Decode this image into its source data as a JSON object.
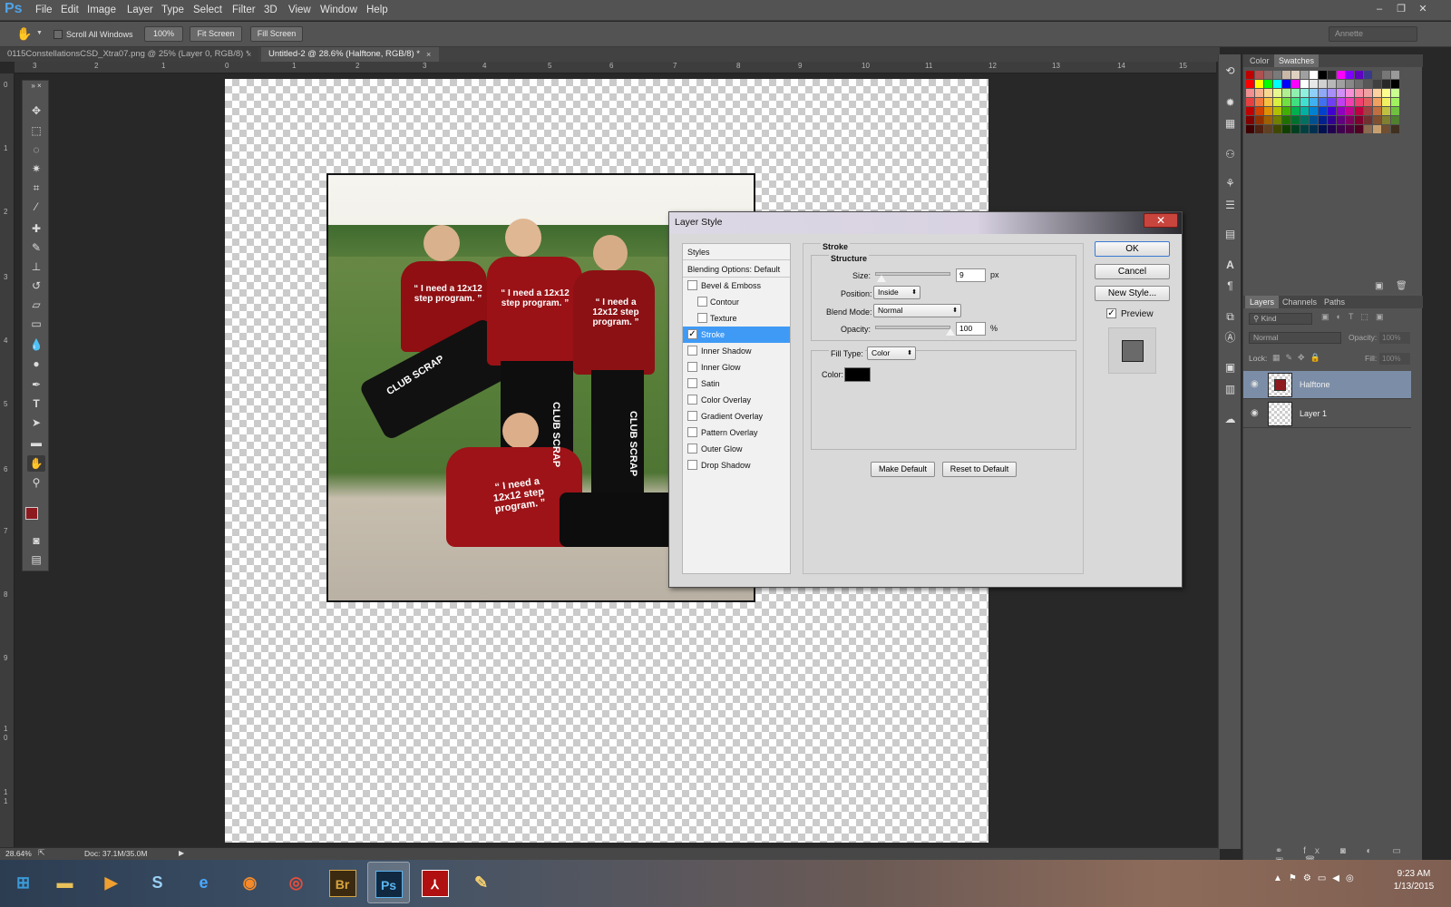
{
  "app": {
    "logo": "Ps",
    "user_workspace": "Annette"
  },
  "menu": [
    "File",
    "Edit",
    "Image",
    "Layer",
    "Type",
    "Select",
    "Filter",
    "3D",
    "View",
    "Window",
    "Help"
  ],
  "window_controls": [
    "–",
    "❐",
    "✕"
  ],
  "options_bar": {
    "scroll_all_windows": "Scroll All Windows",
    "zoom_100": "100%",
    "fit_screen": "Fit Screen",
    "fill_screen": "Fill Screen"
  },
  "doc_tabs": [
    {
      "label": "0115ConstellationsCSD_Xtra07.png @ 25% (Layer 0, RGB/8) *",
      "active": false
    },
    {
      "label": "Untitled-2 @ 28.6% (Halftone, RGB/8) *",
      "active": true
    }
  ],
  "ruler": {
    "h": [
      "3",
      "2",
      "1",
      "0",
      "1",
      "2",
      "3",
      "4",
      "5",
      "6",
      "7",
      "8",
      "9",
      "10",
      "11",
      "12",
      "13",
      "14",
      "15"
    ],
    "v": [
      "0",
      "1",
      "2",
      "3",
      "4",
      "5",
      "6",
      "7",
      "8",
      "9",
      "1",
      "0",
      "1",
      "1"
    ]
  },
  "status": {
    "zoom": "28.64%",
    "doc": "Doc: 37.1M/35.0M"
  },
  "photo_text": {
    "shirt_slogan": "“ I need a 12x12 step program. ”",
    "pants_text": "CLUB SCRAP"
  },
  "dialog": {
    "title": "Layer Style",
    "styles_header": "Styles",
    "blending": "Blending Options: Default",
    "effects": [
      {
        "label": "Bevel & Emboss",
        "checked": false,
        "indent": false
      },
      {
        "label": "Contour",
        "checked": false,
        "indent": true
      },
      {
        "label": "Texture",
        "checked": false,
        "indent": true
      },
      {
        "label": "Stroke",
        "checked": true,
        "indent": false,
        "selected": true
      },
      {
        "label": "Inner Shadow",
        "checked": false,
        "indent": false
      },
      {
        "label": "Inner Glow",
        "checked": false,
        "indent": false
      },
      {
        "label": "Satin",
        "checked": false,
        "indent": false
      },
      {
        "label": "Color Overlay",
        "checked": false,
        "indent": false
      },
      {
        "label": "Gradient Overlay",
        "checked": false,
        "indent": false
      },
      {
        "label": "Pattern Overlay",
        "checked": false,
        "indent": false
      },
      {
        "label": "Outer Glow",
        "checked": false,
        "indent": false
      },
      {
        "label": "Drop Shadow",
        "checked": false,
        "indent": false
      }
    ],
    "section_title": "Stroke",
    "structure_title": "Structure",
    "size_label": "Size:",
    "size_value": "9",
    "size_unit": "px",
    "size_fraction": 0.09,
    "position_label": "Position:",
    "position_value": "Inside",
    "blend_label": "Blend Mode:",
    "blend_value": "Normal",
    "opacity_label": "Opacity:",
    "opacity_value": "100",
    "opacity_unit": "%",
    "opacity_fraction": 1.0,
    "fill_type_label": "Fill Type:",
    "fill_type_value": "Color",
    "color_label": "Color:",
    "stroke_color": "#000000",
    "make_default": "Make Default",
    "reset_default": "Reset to Default",
    "ok": "OK",
    "cancel": "Cancel",
    "new_style": "New Style...",
    "preview_label": "Preview",
    "preview_checked": true
  },
  "panels": {
    "color_tabs": [
      "Color",
      "Swatches"
    ],
    "layers_tabs": [
      "Layers",
      "Channels",
      "Paths"
    ],
    "kind": "Kind",
    "blend_mode": "Normal",
    "opacity_label": "Opacity:",
    "opacity_value": "100%",
    "lock_label": "Lock:",
    "fill_label": "Fill:",
    "fill_value": "100%",
    "layers": [
      {
        "name": "Halftone",
        "active": true
      },
      {
        "name": "Layer 1",
        "active": false
      }
    ]
  },
  "swatch_colors": [
    [
      "#c00000",
      "#b05050",
      "#8b6a6a",
      "#7a7a7a",
      "#c9b8a8",
      "#e0d0c0",
      "#a0a0a0",
      "#ffffff",
      "#000000",
      "#2a2a2a",
      "#ff00ff",
      "#8000ff",
      "#6000c0",
      "#3a3a8a",
      "#555555",
      "#777777",
      "#999999"
    ],
    [
      "#ff0000",
      "#ffff00",
      "#00ff00",
      "#00ffff",
      "#0000ff",
      "#ff00ff",
      "#ffffff",
      "#e8e8e8",
      "#d0d0d0",
      "#b8b8b8",
      "#a0a0a0",
      "#888888",
      "#707070",
      "#585858",
      "#404040",
      "#282828",
      "#000000"
    ],
    [
      "#f09090",
      "#f4b090",
      "#f8d890",
      "#e8f890",
      "#b0f090",
      "#90f0b0",
      "#90f0e0",
      "#90d0f8",
      "#90a8f8",
      "#a890f8",
      "#d090f8",
      "#f890d8",
      "#f890a8",
      "#f0a0a0",
      "#ffd0a0",
      "#ffff90",
      "#c8ff90"
    ],
    [
      "#e84040",
      "#f07840",
      "#f8c040",
      "#d8f040",
      "#70e040",
      "#40e080",
      "#40e0d0",
      "#40b0f0",
      "#4070f0",
      "#7040f0",
      "#c040f0",
      "#f040b0",
      "#f04070",
      "#e06060",
      "#f0a060",
      "#f0f060",
      "#a0f060"
    ],
    [
      "#c00000",
      "#d04000",
      "#e09000",
      "#b0c000",
      "#40b000",
      "#00b050",
      "#00b0a0",
      "#0080d0",
      "#0040d0",
      "#4000d0",
      "#9000c0",
      "#c00090",
      "#c00040",
      "#a04040",
      "#c07040",
      "#c0c040",
      "#70c040"
    ],
    [
      "#800000",
      "#903000",
      "#a06000",
      "#708000",
      "#207000",
      "#007030",
      "#007060",
      "#005090",
      "#002090",
      "#300090",
      "#600080",
      "#800060",
      "#800030",
      "#703030",
      "#805030",
      "#808030",
      "#508030"
    ],
    [
      "#400000",
      "#502010",
      "#604020",
      "#404800",
      "#104000",
      "#004020",
      "#004040",
      "#003050",
      "#001050",
      "#200050",
      "#400050",
      "#500040",
      "#500020",
      "#8b6a50",
      "#c8a070",
      "#705030",
      "#403020"
    ]
  ],
  "taskbar": {
    "time": "9:23 AM",
    "date": "1/13/2015",
    "apps": [
      {
        "name": "start",
        "glyph": "⊞"
      },
      {
        "name": "explorer",
        "glyph": "▬"
      },
      {
        "name": "media",
        "glyph": "▶"
      },
      {
        "name": "app-s",
        "glyph": "S"
      },
      {
        "name": "ie",
        "glyph": "e"
      },
      {
        "name": "firefox",
        "glyph": "◉"
      },
      {
        "name": "chrome",
        "glyph": "◎"
      },
      {
        "name": "bridge",
        "glyph": "Br"
      },
      {
        "name": "photoshop",
        "glyph": "Ps"
      },
      {
        "name": "acrobat",
        "glyph": "⅄"
      },
      {
        "name": "paint",
        "glyph": "✎"
      }
    ]
  }
}
